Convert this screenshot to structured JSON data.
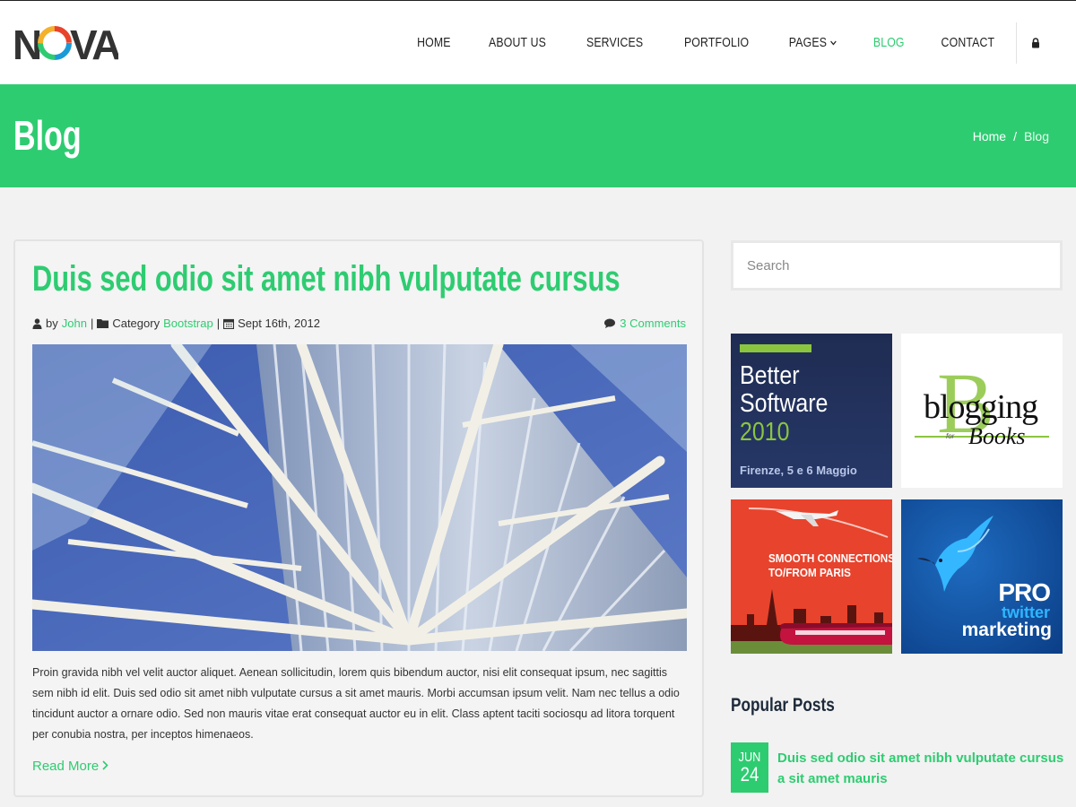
{
  "brand": {
    "logo_text": "NOVA",
    "accent_color": "#2ecc71"
  },
  "nav": {
    "items": [
      {
        "label": "HOME"
      },
      {
        "label": "ABOUT US"
      },
      {
        "label": "SERVICES"
      },
      {
        "label": "PORTFOLIO"
      },
      {
        "label": "PAGES"
      },
      {
        "label": "BLOG",
        "active": true
      },
      {
        "label": "CONTACT"
      }
    ],
    "lock_icon": "lock-icon"
  },
  "banner": {
    "title": "Blog",
    "breadcrumb": {
      "home": "Home",
      "separator": "/",
      "current": "Blog"
    }
  },
  "post": {
    "title": "Duis sed odio sit amet nibh vulputate cursus",
    "by_label": "by",
    "author": "John",
    "category_label": "Category",
    "category": "Bootstrap",
    "date": "Sept 16th, 2012",
    "comments": "3 Comments",
    "excerpt": "Proin gravida nibh vel velit auctor aliquet. Aenean sollicitudin, lorem quis bibendum auctor, nisi elit consequat ipsum, nec sagittis sem nibh id elit. Duis sed odio sit amet nibh vulputate cursus a sit amet mauris. Morbi accumsan ipsum velit. Nam nec tellus a odio tincidunt auctor a ornare odio. Sed non mauris vitae erat consequat auctor eu in elit. Class aptent taciti sociosqu ad litora torquent per conubia nostra, per inceptos himenaeos.",
    "read_more": "Read More",
    "separator": "|"
  },
  "sidebar": {
    "search_placeholder": "Search",
    "ads": {
      "ad1": {
        "line1": "Better",
        "line2": "Software",
        "line3": "2010",
        "line4": "Firenze, 5 e 6 Maggio"
      },
      "ad2": {
        "big": "B",
        "word1": "blogging",
        "word2": "Books",
        "small": "for"
      },
      "ad3": {
        "line1": "SMOOTH CONNECTIONS",
        "line2": "TO/FROM PARIS"
      },
      "ad4": {
        "line1": "PRO",
        "line2": "twitter",
        "line3": "marketing"
      }
    },
    "popular": {
      "title": "Popular Posts",
      "posts": [
        {
          "month": "JUN",
          "day": "24",
          "title": "Duis sed odio sit amet nibh vulputate cursus a sit amet mauris"
        }
      ]
    }
  }
}
